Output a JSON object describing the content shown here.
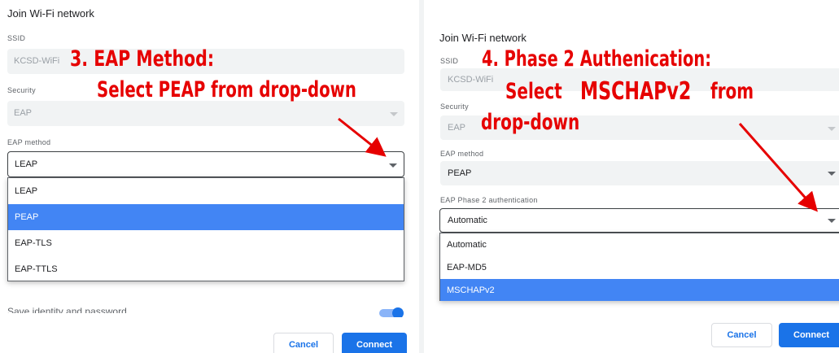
{
  "left_dialog": {
    "title": "Join Wi-Fi network",
    "ssid_label": "SSID",
    "ssid_value": "KCSD-WiFi",
    "security_label": "Security",
    "security_value": "EAP",
    "eap_method_label": "EAP method",
    "eap_method_value": "LEAP",
    "dropdown_options": [
      "LEAP",
      "PEAP",
      "EAP-TLS",
      "EAP-TTLS"
    ],
    "dropdown_selected": "PEAP",
    "save_identity_label": "Save identity and password",
    "save_identity_on": true,
    "cancel_label": "Cancel",
    "connect_label": "Connect"
  },
  "right_dialog": {
    "title": "Join Wi-Fi network",
    "ssid_label": "SSID",
    "ssid_value": "KCSD-WiFi",
    "security_label": "Security",
    "security_value": "EAP",
    "eap_method_label": "EAP method",
    "eap_method_value": "PEAP",
    "phase2_label": "EAP Phase 2 authentication",
    "phase2_value": "Automatic",
    "dropdown_options": [
      "Automatic",
      "EAP-MD5",
      "MSCHAPv2"
    ],
    "dropdown_selected": "MSCHAPv2",
    "cancel_label": "Cancel",
    "connect_label": "Connect"
  },
  "annotations": {
    "left_line1": "3. EAP Method:",
    "left_line2": "Select PEAP from drop-down",
    "right_line1": "4. Phase 2 Authenication:",
    "right_line2_a": "Select",
    "right_line2_b": "MSCHAPv2",
    "right_line2_c": "from",
    "right_line3": "drop-down"
  },
  "colors": {
    "annotation": "#e60000",
    "accent": "#1a73e8",
    "selected_option": "#4285f4",
    "field_bg": "#f1f3f4"
  }
}
